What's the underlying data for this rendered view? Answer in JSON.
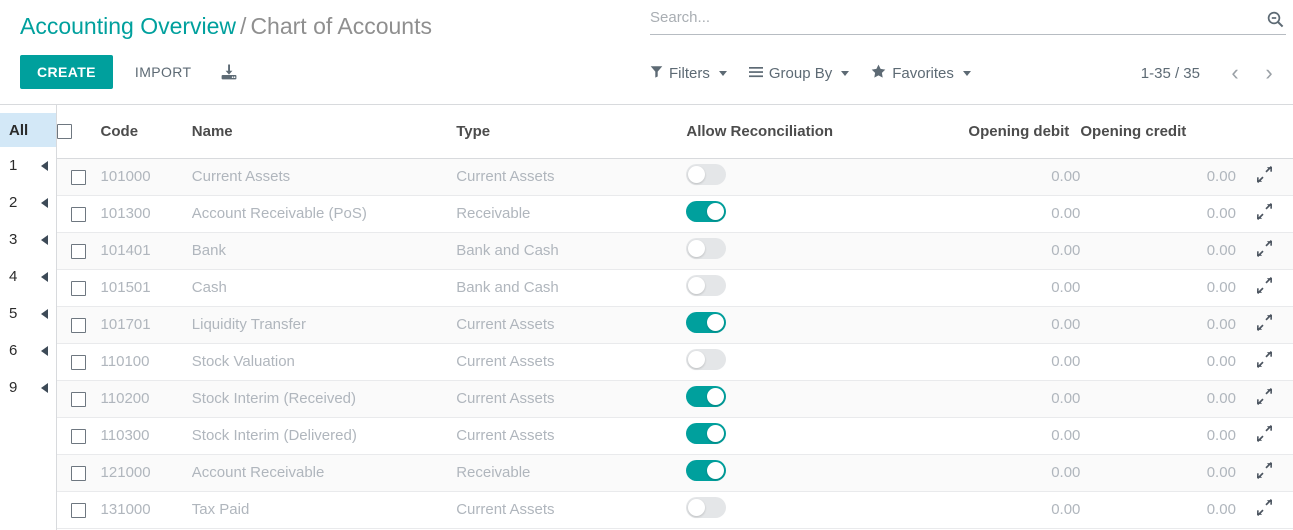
{
  "breadcrumb": {
    "parent": "Accounting Overview",
    "separator": "/",
    "current": "Chart of Accounts"
  },
  "toolbar": {
    "create_label": "CREATE",
    "import_label": "IMPORT",
    "upload_icon": "upload-icon"
  },
  "search": {
    "placeholder": "Search...",
    "value": "",
    "icon": "search-minus-icon"
  },
  "filter_bar": {
    "filters_label": "Filters",
    "group_by_label": "Group By",
    "favorites_label": "Favorites",
    "filters_icon": "funnel-icon",
    "group_by_icon": "hamburger-icon",
    "favorites_icon": "star-icon"
  },
  "pager": {
    "count": "1-35 / 35",
    "prev": "‹",
    "next": "›"
  },
  "sidebar": {
    "items": [
      {
        "label": "All",
        "active": true
      },
      {
        "label": "1",
        "active": false
      },
      {
        "label": "2",
        "active": false
      },
      {
        "label": "3",
        "active": false
      },
      {
        "label": "4",
        "active": false
      },
      {
        "label": "5",
        "active": false
      },
      {
        "label": "6",
        "active": false
      },
      {
        "label": "9",
        "active": false
      }
    ]
  },
  "table": {
    "columns": {
      "code": "Code",
      "name": "Name",
      "type": "Type",
      "allow_reconciliation": "Allow Reconciliation",
      "opening_debit": "Opening debit",
      "opening_credit": "Opening credit"
    },
    "rows": [
      {
        "code": "101000",
        "name": "Current Assets",
        "type": "Current Assets",
        "allow_reconciliation": false,
        "opening_debit": "0.00",
        "opening_credit": "0.00"
      },
      {
        "code": "101300",
        "name": "Account Receivable (PoS)",
        "type": "Receivable",
        "allow_reconciliation": true,
        "opening_debit": "0.00",
        "opening_credit": "0.00"
      },
      {
        "code": "101401",
        "name": "Bank",
        "type": "Bank and Cash",
        "allow_reconciliation": false,
        "opening_debit": "0.00",
        "opening_credit": "0.00"
      },
      {
        "code": "101501",
        "name": "Cash",
        "type": "Bank and Cash",
        "allow_reconciliation": false,
        "opening_debit": "0.00",
        "opening_credit": "0.00"
      },
      {
        "code": "101701",
        "name": "Liquidity Transfer",
        "type": "Current Assets",
        "allow_reconciliation": true,
        "opening_debit": "0.00",
        "opening_credit": "0.00"
      },
      {
        "code": "110100",
        "name": "Stock Valuation",
        "type": "Current Assets",
        "allow_reconciliation": false,
        "opening_debit": "0.00",
        "opening_credit": "0.00"
      },
      {
        "code": "110200",
        "name": "Stock Interim (Received)",
        "type": "Current Assets",
        "allow_reconciliation": true,
        "opening_debit": "0.00",
        "opening_credit": "0.00"
      },
      {
        "code": "110300",
        "name": "Stock Interim (Delivered)",
        "type": "Current Assets",
        "allow_reconciliation": true,
        "opening_debit": "0.00",
        "opening_credit": "0.00"
      },
      {
        "code": "121000",
        "name": "Account Receivable",
        "type": "Receivable",
        "allow_reconciliation": true,
        "opening_debit": "0.00",
        "opening_credit": "0.00"
      },
      {
        "code": "131000",
        "name": "Tax Paid",
        "type": "Current Assets",
        "allow_reconciliation": false,
        "opening_debit": "0.00",
        "opening_credit": "0.00"
      }
    ]
  },
  "colors": {
    "accent": "#00a09d",
    "muted_text": "#b0b6bd",
    "header_text": "#4c4c4c",
    "sidebar_active_bg": "#d3e8f7"
  }
}
